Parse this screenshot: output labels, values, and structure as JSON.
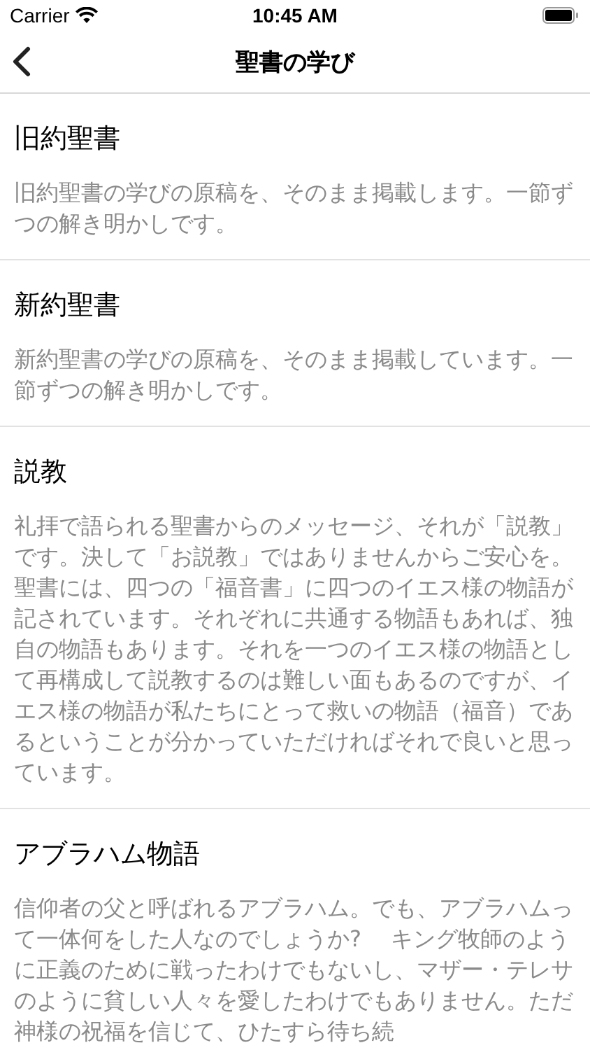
{
  "status_bar": {
    "carrier": "Carrier",
    "time": "10:45 AM"
  },
  "nav_bar": {
    "title": "聖書の学び"
  },
  "sections": [
    {
      "title": "旧約聖書",
      "description": "旧約聖書の学びの原稿を、そのまま掲載します。一節ずつの解き明かしです。"
    },
    {
      "title": "新約聖書",
      "description": "新約聖書の学びの原稿を、そのまま掲載しています。一節ずつの解き明かしです。"
    },
    {
      "title": "説教",
      "description": "礼拝で語られる聖書からのメッセージ、それが「説教」です。決して「お説教」ではありませんからご安心を。聖書には、四つの「福音書」に四つのイエス様の物語が記されています。それぞれに共通する物語もあれば、独自の物語もあります。それを一つのイエス様の物語として再構成して説教するのは難しい面もあるのですが、イエス様の物語が私たちにとって救いの物語（福音）であるということが分かっていただければそれで良いと思っています。"
    },
    {
      "title": "アブラハム物語",
      "description": "信仰者の父と呼ばれるアブラハム。でも、アブラハムって一体何をした人なのでしょうか?　 キング牧師のように正義のために戦ったわけでもないし、マザー・テレサのように貧しい人々を愛したわけでもありません。ただ神様の祝福を信じて、ひたすら待ち続"
    }
  ]
}
